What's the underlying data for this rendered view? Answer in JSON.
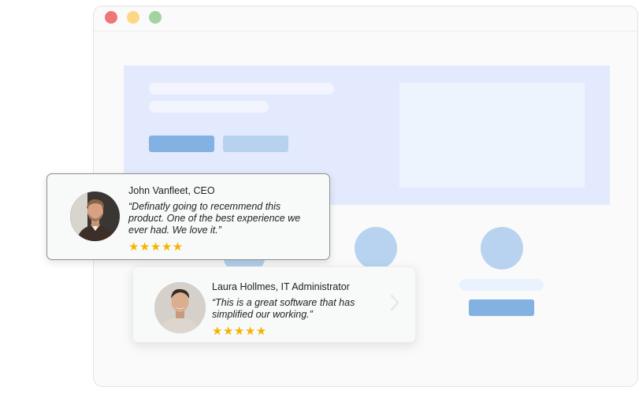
{
  "window": {
    "controls": [
      "close-dot",
      "minimize-dot",
      "maximize-dot"
    ],
    "colors": {
      "close": "#ee7676",
      "minimize": "#fcd884",
      "maximize": "#a3d3a0"
    }
  },
  "testimonials": [
    {
      "name": "John Vanfleet, CEO",
      "quote": "“Definatly going to recemmend this product. One of the best experience we ever had. We love it.”",
      "rating": 5,
      "stars": "★★★★★"
    },
    {
      "name": "Laura Hollmes, IT Administrator",
      "quote": "“This is a great software that has simplified our working.”",
      "rating": 5,
      "stars": "★★★★★"
    }
  ],
  "colors": {
    "accent": "#83b1e2",
    "hero_bg": "#e4eafd",
    "star": "#f5b400"
  }
}
